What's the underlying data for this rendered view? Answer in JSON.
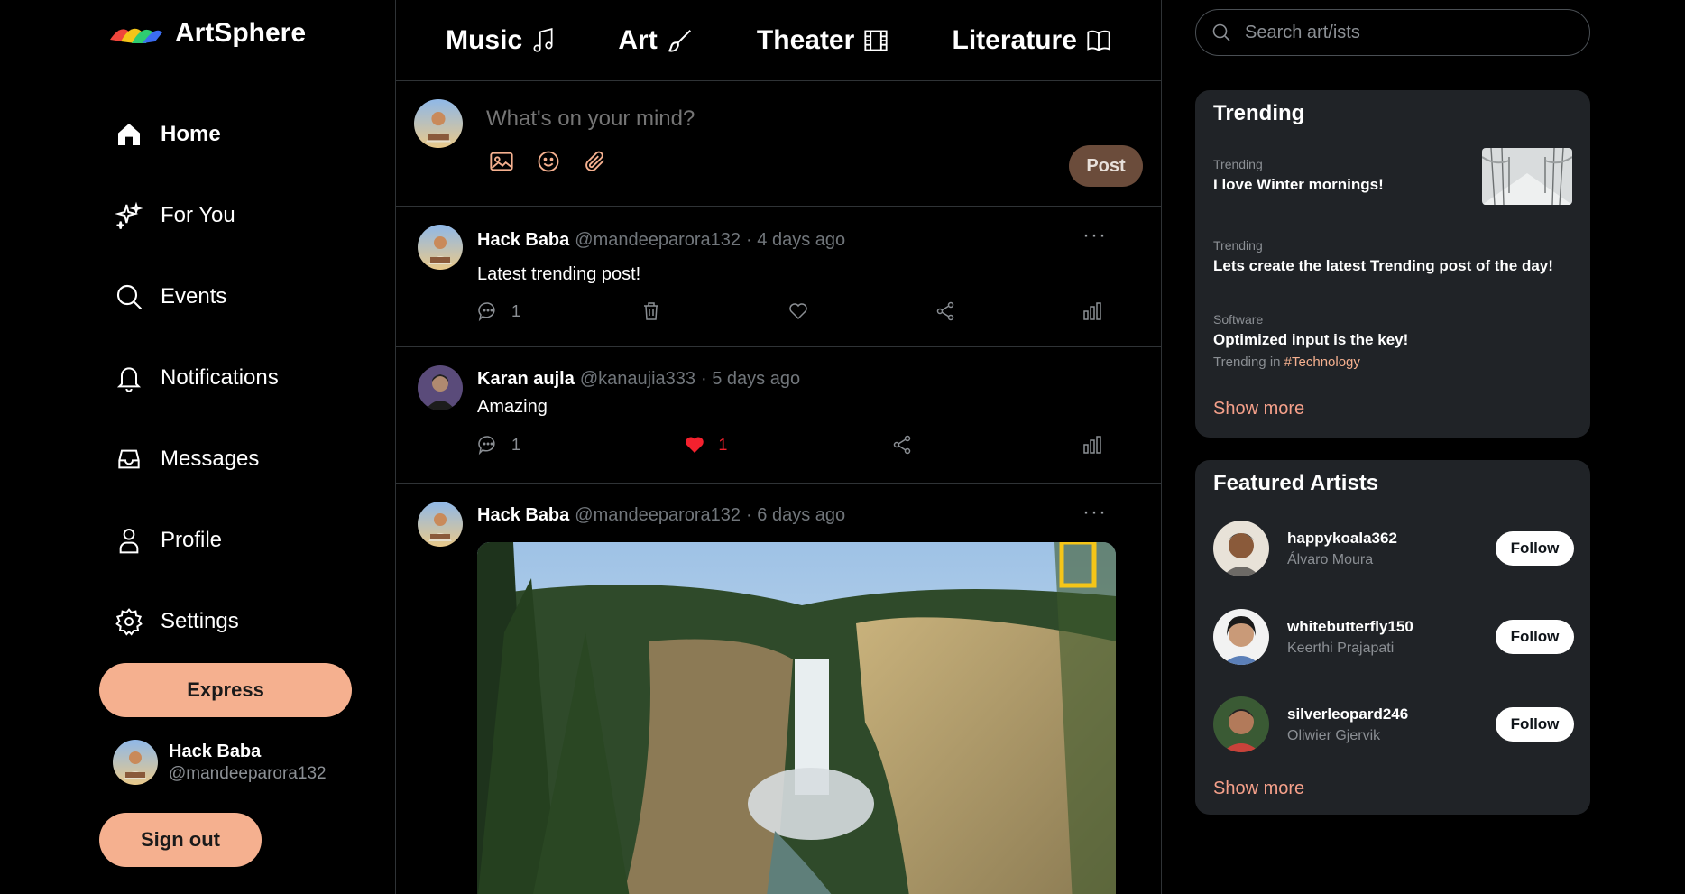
{
  "app": {
    "name": "ArtSphere"
  },
  "nav": {
    "items": [
      {
        "label": "Home",
        "icon": "home-icon"
      },
      {
        "label": "For You",
        "icon": "sparkles-icon"
      },
      {
        "label": "Events",
        "icon": "search-icon"
      },
      {
        "label": "Notifications",
        "icon": "bell-icon"
      },
      {
        "label": "Messages",
        "icon": "inbox-icon"
      },
      {
        "label": "Profile",
        "icon": "user-icon"
      },
      {
        "label": "Settings",
        "icon": "gear-icon"
      }
    ],
    "express_label": "Express",
    "signout_label": "Sign out"
  },
  "current_user": {
    "name": "Hack Baba",
    "handle": "@mandeeparora132"
  },
  "categories": [
    {
      "label": "Music",
      "icon": "music-note-icon"
    },
    {
      "label": "Art",
      "icon": "paintbrush-icon"
    },
    {
      "label": "Theater",
      "icon": "film-icon"
    },
    {
      "label": "Literature",
      "icon": "book-icon"
    }
  ],
  "composer": {
    "placeholder": "What's on your mind?",
    "post_label": "Post"
  },
  "posts": [
    {
      "author": "Hack Baba",
      "handle": "@mandeeparora132",
      "time": "· 4 days ago",
      "text": "Latest trending post!",
      "comments": "1",
      "likes": ""
    },
    {
      "author": "Karan aujla",
      "handle": "@kanaujia333",
      "time": "· 5 days ago",
      "text": "Amazing",
      "comments": "1",
      "likes": "1"
    },
    {
      "author": "Hack Baba",
      "handle": "@mandeeparora132",
      "time": "· 6 days ago",
      "text": "",
      "comments": "",
      "likes": ""
    }
  ],
  "search": {
    "placeholder": "Search art/ists"
  },
  "trending": {
    "title": "Trending",
    "items": [
      {
        "category": "Trending",
        "title": "I love Winter mornings!"
      },
      {
        "category": "Trending",
        "title": "Lets create the latest Trending post of the day!"
      },
      {
        "category": "Software",
        "title": "Optimized input is the key!",
        "sub_prefix": "Trending in",
        "sub_tag": "#Technology"
      }
    ],
    "show_more": "Show more"
  },
  "featured": {
    "title": "Featured Artists",
    "artists": [
      {
        "username": "happykoala362",
        "name": "Álvaro Moura",
        "follow": "Follow"
      },
      {
        "username": "whitebutterfly150",
        "name": "Keerthi Prajapati",
        "follow": "Follow"
      },
      {
        "username": "silverleopard246",
        "name": "Oliwier Gjervik",
        "follow": "Follow"
      }
    ],
    "show_more": "Show more"
  },
  "colors": {
    "accent": "#f5b08f",
    "like": "#f4212e",
    "panel": "#202327",
    "post_button": "#6b4c3b"
  }
}
